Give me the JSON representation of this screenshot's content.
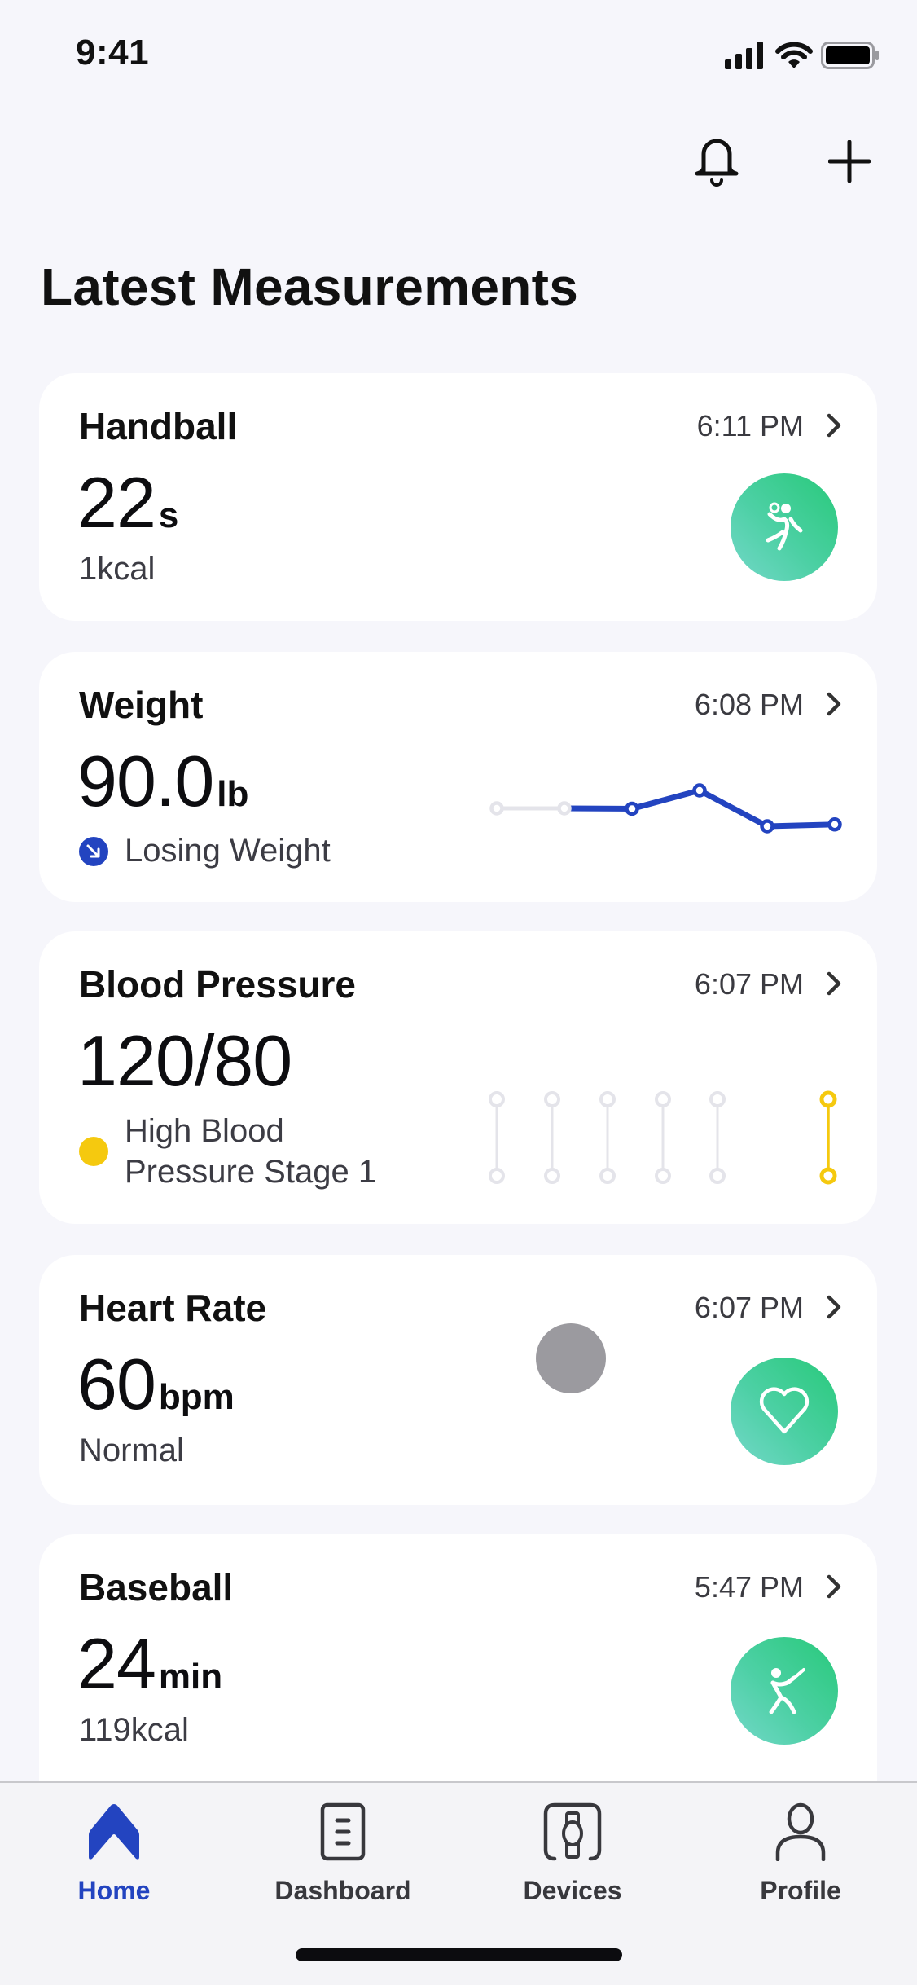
{
  "status_bar": {
    "time": "9:41",
    "icons": [
      "cellular-signal-icon",
      "wifi-icon",
      "battery-icon"
    ]
  },
  "header": {
    "actions": [
      {
        "name": "notifications",
        "icon": "bell-icon"
      },
      {
        "name": "add",
        "icon": "plus-icon"
      }
    ],
    "title": "Latest Measurements"
  },
  "colors": {
    "accent_blue": "#2344c0",
    "warning_yellow": "#f5c90f",
    "badge_green_start": "#74d8c9",
    "badge_green_end": "#28c97a",
    "inactive_gray": "#e4e4ea",
    "background": "#f6f6fb"
  },
  "cards": [
    {
      "title": "Handball",
      "time": "6:11 PM",
      "value": "22",
      "unit": "s",
      "subtitle": "1kcal",
      "icon": "handball-icon"
    },
    {
      "title": "Weight",
      "time": "6:08 PM",
      "value": "90.0",
      "unit": "lb",
      "status": "Losing Weight",
      "status_icon": "arrow-down-right-icon",
      "trend": {
        "type": "line",
        "points_relative": [
          0.5,
          0.5,
          0.49,
          1.0,
          0.0,
          0.05
        ],
        "inactive_count": 2
      }
    },
    {
      "title": "Blood Pressure",
      "time": "6:07 PM",
      "value": "120/80",
      "status": "High Blood Pressure Stage 1",
      "status_line1": "High Blood",
      "status_line2": "Pressure Stage 1",
      "status_color": "#f5c90f",
      "history": {
        "slots": 6,
        "active_index": 5,
        "empty_before_active": true
      }
    },
    {
      "title": "Heart Rate",
      "time": "6:07 PM",
      "value": "60",
      "unit": "bpm",
      "subtitle": "Normal",
      "icon": "heart-icon"
    },
    {
      "title": "Baseball",
      "time": "5:47 PM",
      "value": "24",
      "unit": "min",
      "subtitle": "119kcal",
      "icon": "baseball-batter-icon"
    }
  ],
  "tabbar": {
    "active": "Home",
    "tabs": [
      {
        "label": "Home",
        "icon": "home-icon"
      },
      {
        "label": "Dashboard",
        "icon": "dashboard-icon"
      },
      {
        "label": "Devices",
        "icon": "watch-device-icon"
      },
      {
        "label": "Profile",
        "icon": "person-icon"
      }
    ]
  }
}
